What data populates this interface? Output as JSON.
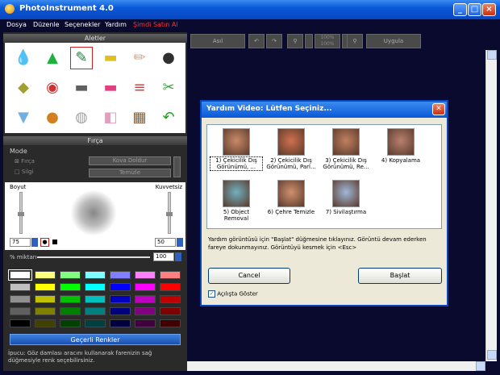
{
  "window": {
    "title": "PhotoInstrument 4.0"
  },
  "menu": {
    "items": [
      "Dosya",
      "Düzenle",
      "Seçenekler",
      "Yardım",
      "Şimdi Satın Al"
    ],
    "buy_color": "#ff3030"
  },
  "tools_panel": {
    "title": "Aletler",
    "tools": [
      {
        "name": "drop-icon",
        "selected": false
      },
      {
        "name": "cone-icon",
        "selected": false
      },
      {
        "name": "brush-icon",
        "selected": true
      },
      {
        "name": "stamp-icon",
        "selected": false
      },
      {
        "name": "eraser-pencil-icon",
        "selected": false
      },
      {
        "name": "pin-icon",
        "selected": false
      },
      {
        "name": "shield-icon",
        "selected": false
      },
      {
        "name": "eye-icon",
        "selected": false
      },
      {
        "name": "gradient-icon",
        "selected": false
      },
      {
        "name": "spectrum-icon",
        "selected": false
      },
      {
        "name": "lines-icon",
        "selected": false
      },
      {
        "name": "scissors-icon",
        "selected": false
      },
      {
        "name": "tube-icon",
        "selected": false
      },
      {
        "name": "bottle-icon",
        "selected": false
      },
      {
        "name": "lamp-icon",
        "selected": false
      },
      {
        "name": "rubber-icon",
        "selected": false
      },
      {
        "name": "film-icon",
        "selected": false
      },
      {
        "name": "undo-arrow-icon",
        "selected": false
      }
    ]
  },
  "brush_panel": {
    "title": "Fırça",
    "mode_label": "Mode",
    "mode_brush": "Fırça",
    "mode_erase": "Silgi",
    "fill_button": "Kova Doldur",
    "clear_button": "Temizle",
    "size_label": "Boyut",
    "strength_label": "Kuvvetsiz",
    "size_value": "75",
    "strength_value": "50",
    "percent_label": "% miktarı",
    "percent_value": "100"
  },
  "palette": {
    "rows": [
      [
        "#ffffff",
        "#ffff80",
        "#80ff80",
        "#80ffff",
        "#8080ff",
        "#ff80ff",
        "#ff8080"
      ],
      [
        "#c0c0c0",
        "#ffff00",
        "#00ff00",
        "#00ffff",
        "#0000ff",
        "#ff00ff",
        "#ff0000"
      ],
      [
        "#909090",
        "#c0c000",
        "#00c000",
        "#00c0c0",
        "#0000c0",
        "#c000c0",
        "#c00000"
      ],
      [
        "#606060",
        "#808000",
        "#008000",
        "#008080",
        "#000080",
        "#800080",
        "#800000"
      ],
      [
        "#000000",
        "#404000",
        "#004000",
        "#004040",
        "#000040",
        "#400040",
        "#400000"
      ]
    ],
    "selected_row": 0,
    "selected_col": 0
  },
  "valid_colors_button": "Geçerli Renkler",
  "tip": "İpucu: Göz damlası aracını kullanarak farenizin sağ düğmesiyle renk seçebilirsiniz.",
  "toolbar": {
    "original_label": "Asıl",
    "zoom_top": "100%",
    "zoom_bottom": "100%",
    "apply_label": "Uygula"
  },
  "dialog": {
    "title": "Yardım Video: Lütfen Seçiniz...",
    "items": [
      {
        "label": "1) Çekicilik Dış Görünümü, ...",
        "thumb": "#c98a6a",
        "selected": true
      },
      {
        "label": "2) Çekicilik Dış Görünümü, Parl...",
        "thumb": "#d07050",
        "selected": false
      },
      {
        "label": "3) Çekicilik Dış Görünümü, Re...",
        "thumb": "#c08060",
        "selected": false
      },
      {
        "label": "4) Kopyalama",
        "thumb": "#b88070",
        "selected": false
      },
      {
        "label": "5) Object Removal",
        "thumb": "#70b0c0",
        "selected": false
      },
      {
        "label": "6) Çehre Temizle",
        "thumb": "#d09070",
        "selected": false
      },
      {
        "label": "7) Sivilaştırma",
        "thumb": "#a0b8d8",
        "selected": false
      }
    ],
    "info": "Yardım görüntüsü için \"Başlat\" düğmesine tıklayınız. Görüntü devam ederken fareye dokunmayınız. Görüntüyü kesmek için <Esc>",
    "cancel": "Cancel",
    "start": "Başlat",
    "show_on_start": "Açılışta Göster",
    "show_on_start_checked": true
  }
}
